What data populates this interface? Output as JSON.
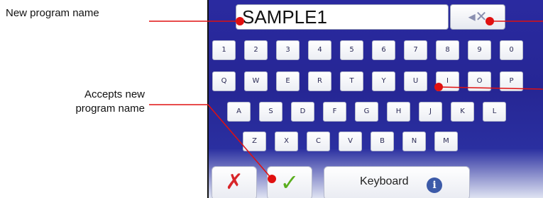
{
  "callouts": {
    "new_program_name": "New program name",
    "accepts_new_name": "Accepts new\nprogram name"
  },
  "name_field": {
    "value": "SAMPLE1"
  },
  "backspace": {
    "icon": "backspace-icon",
    "glyph": "◂✕"
  },
  "keyboard": {
    "rows": [
      [
        "1",
        "2",
        "3",
        "4",
        "5",
        "6",
        "7",
        "8",
        "9",
        "0"
      ],
      [
        "Q",
        "W",
        "E",
        "R",
        "T",
        "Y",
        "U",
        "I",
        "O",
        "P"
      ],
      [
        "A",
        "S",
        "D",
        "F",
        "G",
        "H",
        "J",
        "K",
        "L"
      ],
      [
        "Z",
        "X",
        "C",
        "V",
        "B",
        "N",
        "M"
      ]
    ]
  },
  "bottom_bar": {
    "cancel_glyph": "✗",
    "ok_glyph": "✓",
    "keyboard_label": "Keyboard",
    "info_glyph": "i"
  },
  "colors": {
    "panel_blue": "#2a2aa0",
    "callout_line": "#e01010",
    "cancel": "#d8262a",
    "ok": "#5aae1e"
  }
}
